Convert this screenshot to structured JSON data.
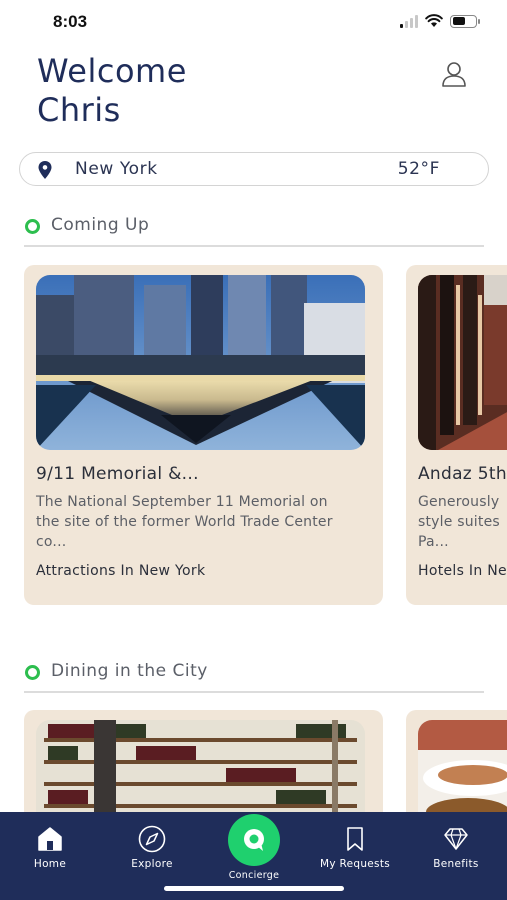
{
  "status": {
    "time": "8:03"
  },
  "header": {
    "greeting": "Welcome",
    "name": "Chris"
  },
  "location": {
    "city": "New York",
    "temperature": "52°F"
  },
  "sections": [
    {
      "title": "Coming Up",
      "cards": [
        {
          "title": "9/11 Memorial &...",
          "description": "The National September 11 Memorial on the site of the former World Trade Center co...",
          "category": "Attractions In New York"
        },
        {
          "title": "Andaz 5th",
          "description": "Generously style suites Pa...",
          "desc_lines": [
            "Generously",
            "style suites",
            "Pa..."
          ],
          "category": "Hotels In Ne"
        }
      ]
    },
    {
      "title": "Dining in the City"
    }
  ],
  "tabs": [
    {
      "label": "Home",
      "icon": "home-icon"
    },
    {
      "label": "Explore",
      "icon": "compass-icon"
    },
    {
      "label": "Concierge",
      "icon": "concierge-chat-icon"
    },
    {
      "label": "My Requests",
      "icon": "bookmark-icon"
    },
    {
      "label": "Benefits",
      "icon": "diamond-icon"
    }
  ],
  "colors": {
    "navy": "#1f2d5a",
    "accent_green": "#2dbe4e",
    "concierge_green": "#1fd06e",
    "card_beige": "#f1e6d8"
  }
}
